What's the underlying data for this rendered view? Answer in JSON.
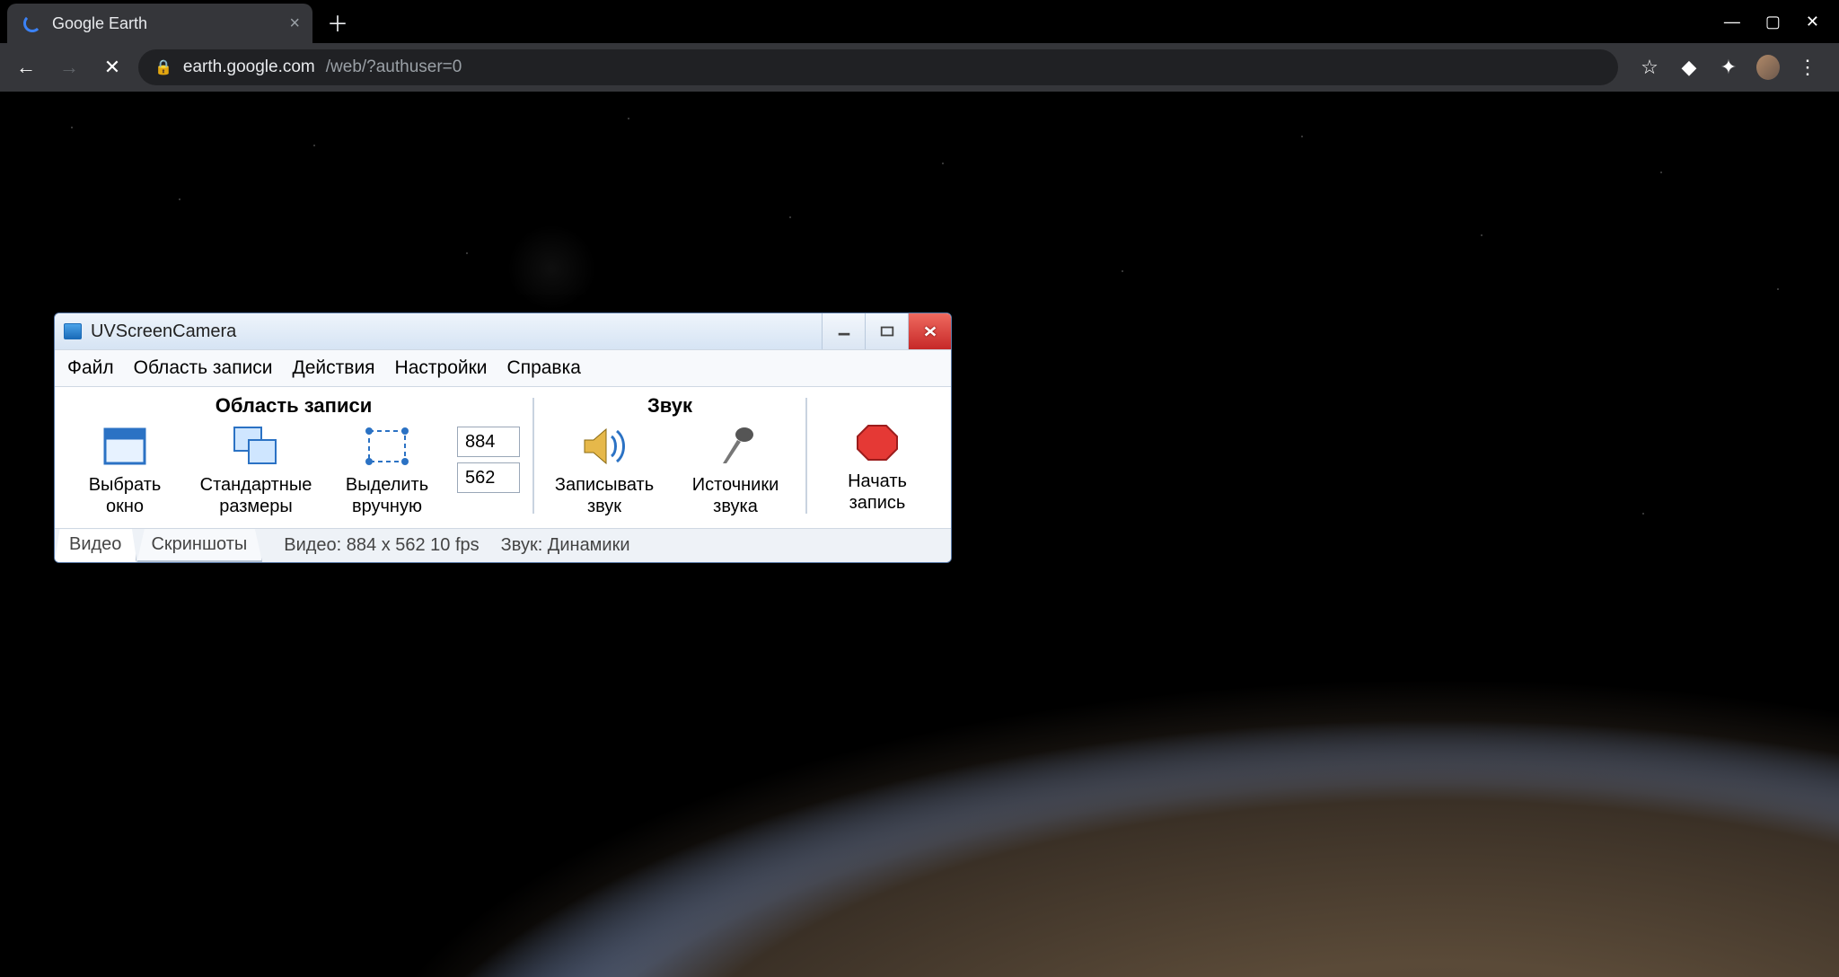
{
  "browser": {
    "tab_title": "Google Earth",
    "url_host": "earth.google.com",
    "url_path": "/web/?authuser=0"
  },
  "uv": {
    "title": "UVScreenCamera",
    "menu": {
      "file": "Файл",
      "area": "Область записи",
      "actions": "Действия",
      "settings": "Настройки",
      "help": "Справка"
    },
    "groups": {
      "area_header": "Область записи",
      "sound_header": "Звук"
    },
    "buttons": {
      "select_window": "Выбрать\nокно",
      "std_sizes": "Стандартные\nразмеры",
      "select_manual": "Выделить\nвручную",
      "record_sound": "Записывать\nзвук",
      "sound_sources": "Источники\nзвука",
      "start_record": "Начать\nзапись"
    },
    "dims": {
      "width": "884",
      "height": "562"
    },
    "tabs": {
      "video": "Видео",
      "screenshots": "Скриншоты"
    },
    "status": {
      "video": "Видео: 884 x 562  10 fps",
      "sound": "Звук:  Динамики"
    }
  }
}
